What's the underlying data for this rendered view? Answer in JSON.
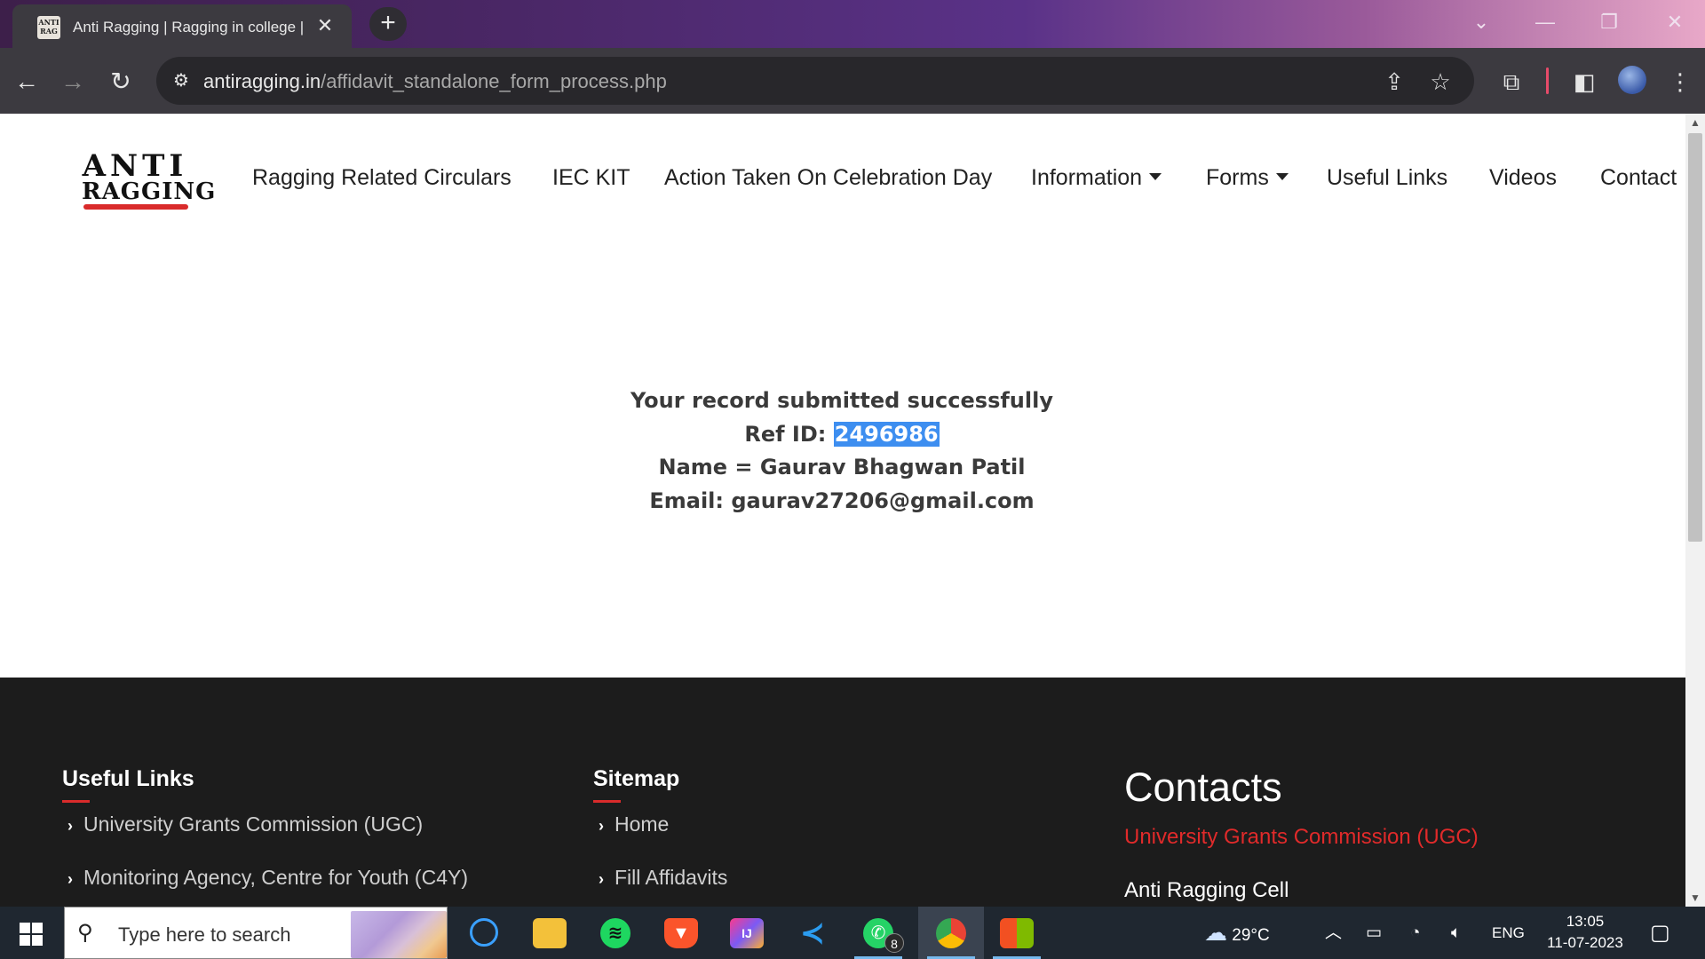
{
  "browser": {
    "tab_title": "Anti Ragging | Ragging in college |",
    "new_tab_label": "+",
    "url_domain": "antiragging.in",
    "url_path": "/affidavit_standalone_form_process.php"
  },
  "site": {
    "logo_line1": "ANTI",
    "logo_line2": "RAGGING",
    "nav": [
      {
        "label": "Ragging Related Circulars"
      },
      {
        "label": "IEC KIT"
      },
      {
        "label": "Action Taken On Celebration Day"
      },
      {
        "label": "Information",
        "dropdown": true
      },
      {
        "label": "Forms",
        "dropdown": true
      },
      {
        "label": "Useful Links"
      },
      {
        "label": "Videos"
      },
      {
        "label": "Contact"
      }
    ]
  },
  "result": {
    "message": "Your record submitted successfully",
    "ref_label": "Ref ID: ",
    "ref_id": "2496986",
    "name_line": "Name = Gaurav Bhagwan Patil",
    "email_line": "Email: gaurav27206@gmail.com"
  },
  "footer": {
    "useful_links_title": "Useful Links",
    "useful_links": [
      "University Grants Commission (UGC)",
      "Monitoring Agency, Centre for Youth (C4Y)"
    ],
    "sitemap_title": "Sitemap",
    "sitemap": [
      "Home",
      "Fill Affidavits"
    ],
    "contacts_title": "Contacts",
    "contacts_org": "University Grants Commission (UGC)",
    "contacts_cell": "Anti Ragging Cell"
  },
  "taskbar": {
    "search_placeholder": "Type here to search",
    "whatsapp_badge": "8",
    "weather": "29°C",
    "language": "ENG",
    "time": "13:05",
    "date": "11-07-2023"
  },
  "colors": {
    "accent_red": "#d92b2b",
    "footer_bg": "#1c1c1c",
    "selection": "#3d8ef0"
  }
}
